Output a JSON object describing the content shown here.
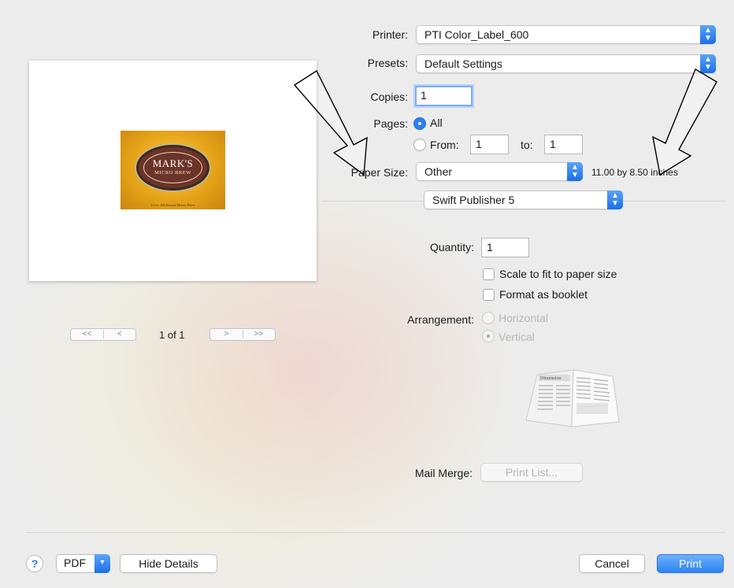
{
  "printer": {
    "label": "Printer:",
    "value": "PTI Color_Label_600"
  },
  "presets": {
    "label": "Presets:",
    "value": "Default Settings"
  },
  "copies": {
    "label": "Copies:",
    "value": "1"
  },
  "pages": {
    "label": "Pages:",
    "all_label": "All",
    "from_label": "From:",
    "from_value": "1",
    "to_label": "to:",
    "to_value": "1"
  },
  "paper_size": {
    "label": "Paper Size:",
    "value": "Other",
    "dimensions": "11.00 by 8.50 inches"
  },
  "section_popup": {
    "value": "Swift Publisher 5"
  },
  "quantity": {
    "label": "Quantity:",
    "value": "1"
  },
  "options": {
    "scale_label": "Scale to fit to paper size",
    "booklet_label": "Format as booklet"
  },
  "arrangement": {
    "label": "Arrangement:",
    "horizontal_label": "Horizontal",
    "vertical_label": "Vertical"
  },
  "mail_merge": {
    "label": "Mail Merge:",
    "button_label": "Print List..."
  },
  "preview": {
    "page_indicator": "1 of 1",
    "first_glyph": "<<",
    "prev_glyph": "<",
    "next_glyph": ">",
    "last_glyph": ">>",
    "label_title": "MARK'S",
    "label_subtitle": "MICRO BREW",
    "label_footer": "12 oz. All Natural Honey Brew",
    "booklet_heading": "Dimension"
  },
  "footer": {
    "help_glyph": "?",
    "pdf_label": "PDF",
    "hide_details_label": "Hide Details",
    "cancel_label": "Cancel",
    "print_label": "Print"
  },
  "colors": {
    "accent": "#2a7ff3",
    "background": "#ececec"
  }
}
